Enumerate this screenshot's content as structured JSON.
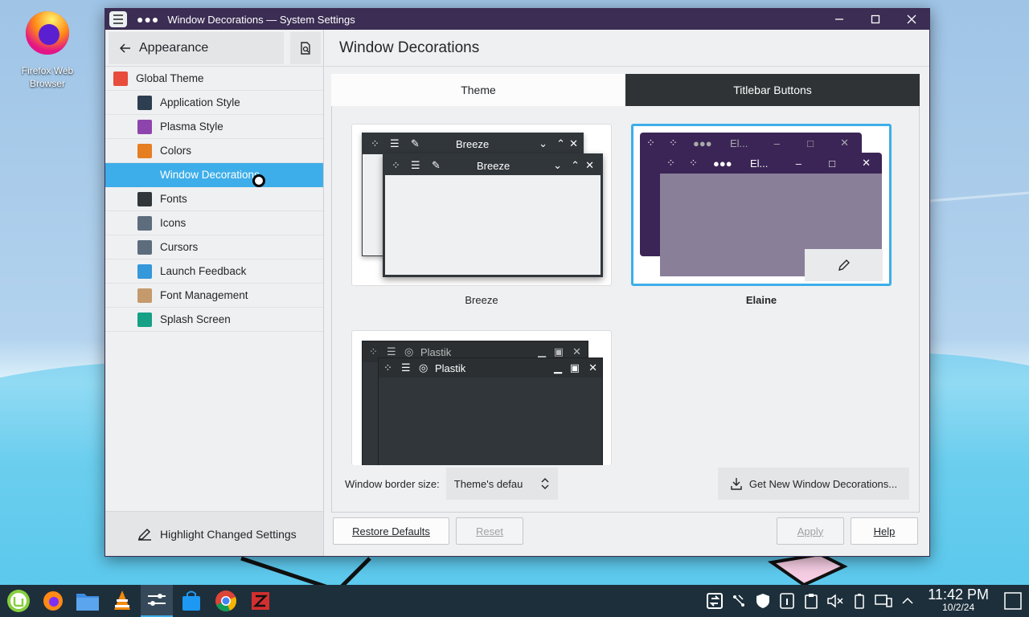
{
  "desktop": {
    "icons": [
      {
        "label_line1": "Firefox Web",
        "label_line2": "Browser"
      }
    ]
  },
  "window": {
    "title_dots": "●●●",
    "title": "Window Decorations — System Settings"
  },
  "sidebar": {
    "back_label": "Appearance",
    "items": [
      {
        "label": "Global Theme",
        "icon": "global-theme-icon",
        "color": "#e74c3c"
      },
      {
        "label": "Application Style",
        "icon": "application-style-icon",
        "color": "#2c3e50"
      },
      {
        "label": "Plasma Style",
        "icon": "plasma-style-icon",
        "color": "#8e44ad"
      },
      {
        "label": "Colors",
        "icon": "colors-icon",
        "color": "#e67e22"
      },
      {
        "label": "Window Decorations",
        "icon": "window-decorations-icon",
        "color": "#3daee9"
      },
      {
        "label": "Fonts",
        "icon": "fonts-icon",
        "color": "#31363b"
      },
      {
        "label": "Icons",
        "icon": "icons-icon",
        "color": "#5d6d7e"
      },
      {
        "label": "Cursors",
        "icon": "cursors-icon",
        "color": "#5d6d7e"
      },
      {
        "label": "Launch Feedback",
        "icon": "launch-feedback-icon",
        "color": "#3498db"
      },
      {
        "label": "Font Management",
        "icon": "font-management-icon",
        "color": "#c49a6c"
      },
      {
        "label": "Splash Screen",
        "icon": "splash-screen-icon",
        "color": "#16a085"
      }
    ],
    "footer_label": "Highlight Changed Settings"
  },
  "main": {
    "title": "Window Decorations",
    "tabs": [
      {
        "label": "Theme",
        "active": true
      },
      {
        "label": "Titlebar Buttons",
        "active": false
      }
    ],
    "themes": [
      {
        "name": "Breeze",
        "selected": false,
        "back_title": "Breeze",
        "front_title": "Breeze"
      },
      {
        "name": "Elaine",
        "selected": true,
        "back_title": "El...",
        "front_title": "El..."
      },
      {
        "name": "Plastik",
        "selected": false,
        "back_title": "Plastik",
        "front_title": "Plastik"
      }
    ],
    "border_size_label": "Window border size:",
    "border_size_value": "Theme's defau",
    "get_new_label": "Get New Window Decorations..."
  },
  "buttons": {
    "restore_defaults": "Restore Defaults",
    "reset": "Reset",
    "apply": "Apply",
    "help": "Help"
  },
  "taskbar": {
    "time": "11:42 PM",
    "date": "10/2/24"
  },
  "colors": {
    "accent": "#3daee9",
    "titlebar": "#3b2d53",
    "elaine": "#3b2556",
    "breeze_tab_dark": "#2f3336"
  }
}
